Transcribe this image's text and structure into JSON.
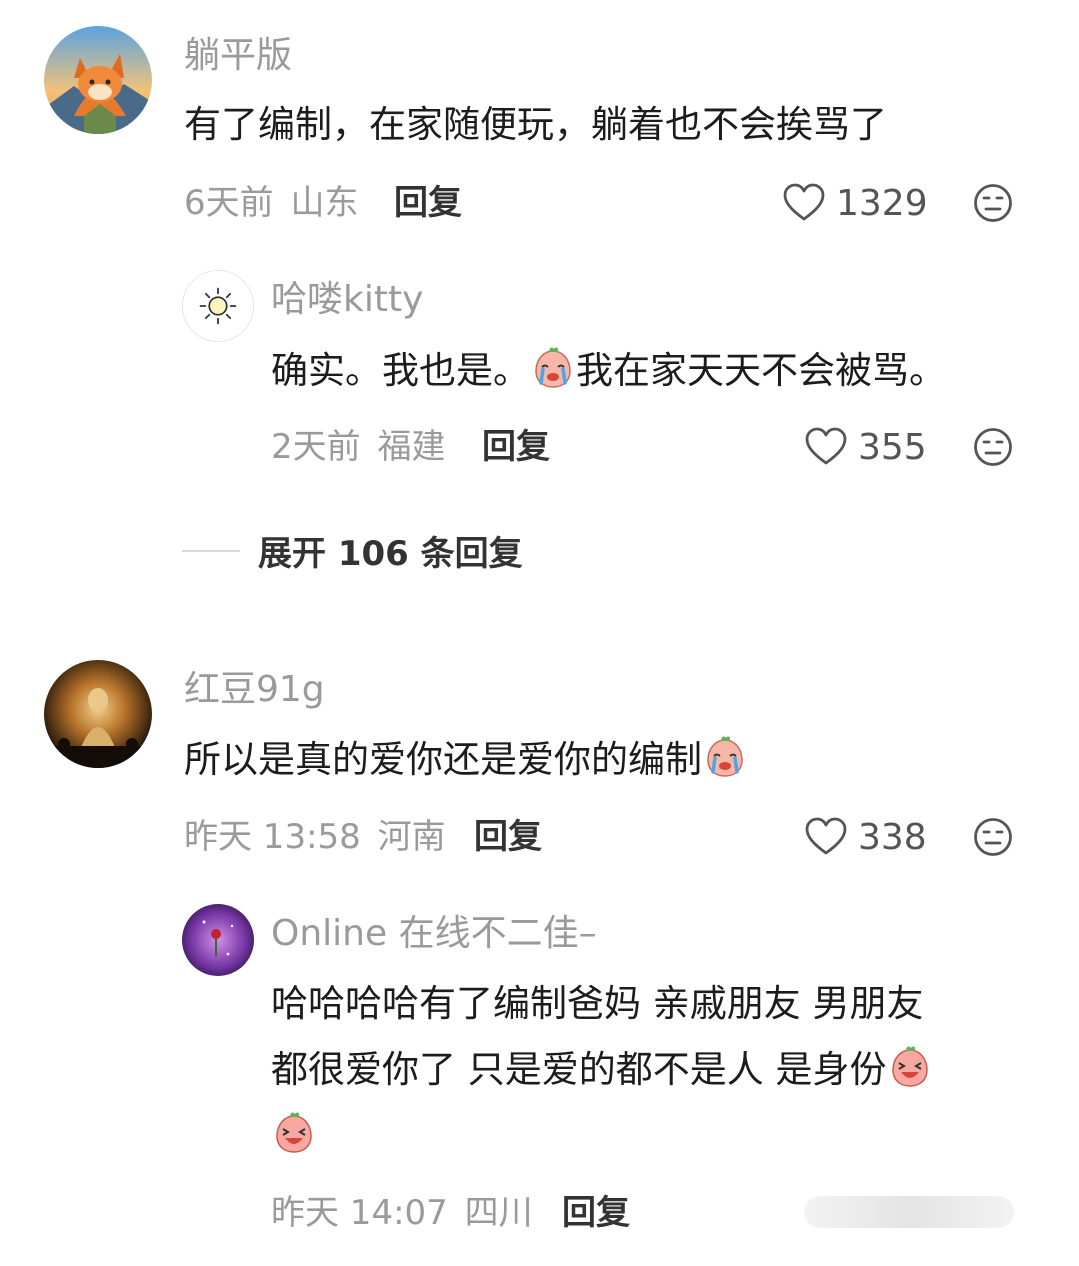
{
  "comments": [
    {
      "username": "躺平版",
      "text": "有了编制，在家随便玩，躺着也不会挨骂了",
      "time": "6天前",
      "location": "山东",
      "reply_label": "回复",
      "likes": "1329",
      "avatar": "fox-avatar",
      "reply": {
        "username": "哈喽kitty",
        "text_before_emoji": "确实。我也是。",
        "emoji": "crying-peach-emoji",
        "text_after_emoji": "我在家天天不会被骂。",
        "time": "2天前",
        "location": "福建",
        "reply_label": "回复",
        "likes": "355",
        "avatar": "sun-avatar"
      },
      "expand_label": "展开 106 条回复"
    },
    {
      "username": "红豆91g",
      "text": "所以是真的爱你还是爱你的编制",
      "emoji": "crying-peach-emoji",
      "time": "昨天 13:58",
      "location": "河南",
      "reply_label": "回复",
      "likes": "338",
      "avatar": "buddha-avatar",
      "reply": {
        "username": "Online 在线不二佳–",
        "line1": "哈哈哈哈有了编制爸妈 亲戚朋友 男朋友",
        "line2": "都很爱你了 只是爱的都不是人 是身份",
        "emoji": "laughing-peach-emoji",
        "time": "昨天 14:07",
        "location": "四川",
        "reply_label": "回复",
        "avatar": "purple-avatar"
      }
    }
  ],
  "colors": {
    "meta_gray": "#9a9a9a",
    "text_dark": "#1c1c1c",
    "background": "#ffffff"
  }
}
